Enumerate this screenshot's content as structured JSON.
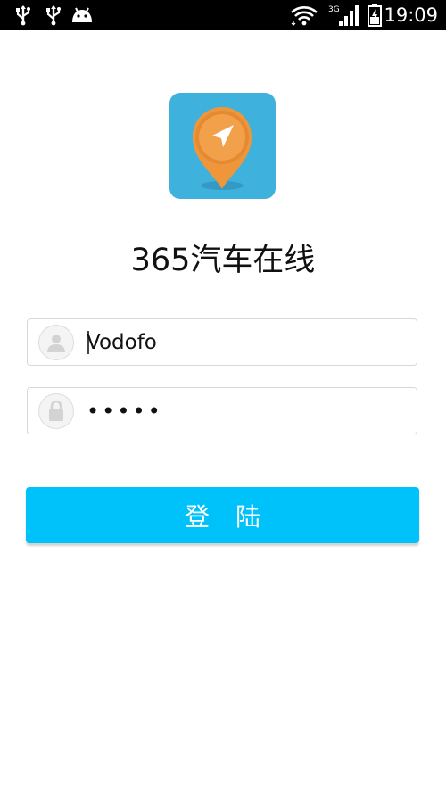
{
  "status_bar": {
    "time": "19:09",
    "network_type": "3G",
    "icons": [
      "usb-icon",
      "usb-icon",
      "android-icon",
      "wifi-icon",
      "signal-icon",
      "battery-charging-icon"
    ]
  },
  "app": {
    "title": "365汽车在线",
    "logo_icon": "location-pin-navigation-icon"
  },
  "login_form": {
    "username": {
      "value": "Vodofo",
      "icon": "user-icon"
    },
    "password": {
      "masked_value": "•••••",
      "icon": "lock-icon"
    },
    "submit_label": "登 陆"
  },
  "colors": {
    "status_bar_bg": "#000000",
    "logo_bg": "#3fb1dd",
    "pin_orange": "#f0963a",
    "button_bg": "#00c2fa",
    "button_text": "#ffffff"
  }
}
